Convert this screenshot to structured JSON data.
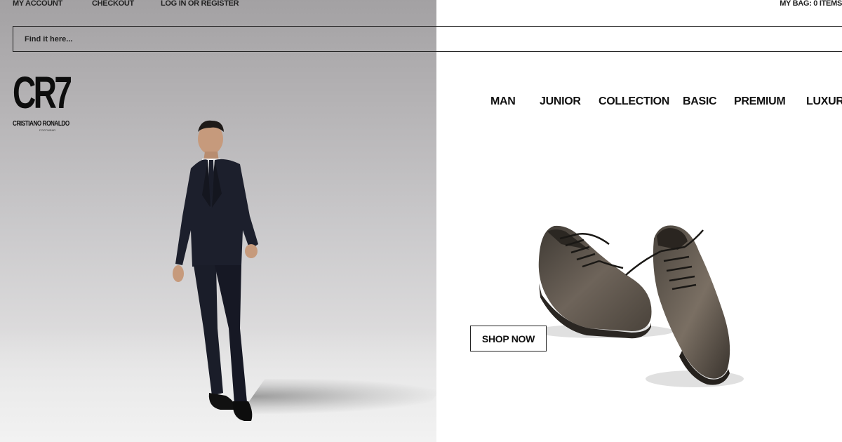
{
  "top_bar": {
    "my_account": "MY ACCOUNT",
    "checkout": "CHECKOUT",
    "login_register": "LOG IN OR REGISTER",
    "my_bag": "MY BAG: 0 ITEMS"
  },
  "search": {
    "placeholder": "Find it here..."
  },
  "logo": {
    "mark": "CR7",
    "subtitle": "CRISTIANO RONALDO",
    "tagline": "FOOTWEAR"
  },
  "nav": {
    "items": [
      {
        "label": "MAN"
      },
      {
        "label": "JUNIOR"
      },
      {
        "label": "COLLECTION"
      },
      {
        "label": "BASIC"
      },
      {
        "label": "PREMIUM"
      },
      {
        "label": "LUXURY"
      }
    ]
  },
  "hero": {
    "cta_label": "SHOP NOW"
  },
  "colors": {
    "text": "#111111",
    "hero_bg": "#b6b4b6",
    "page_bg": "#ffffff",
    "shoe_leather": "#5a5148"
  }
}
